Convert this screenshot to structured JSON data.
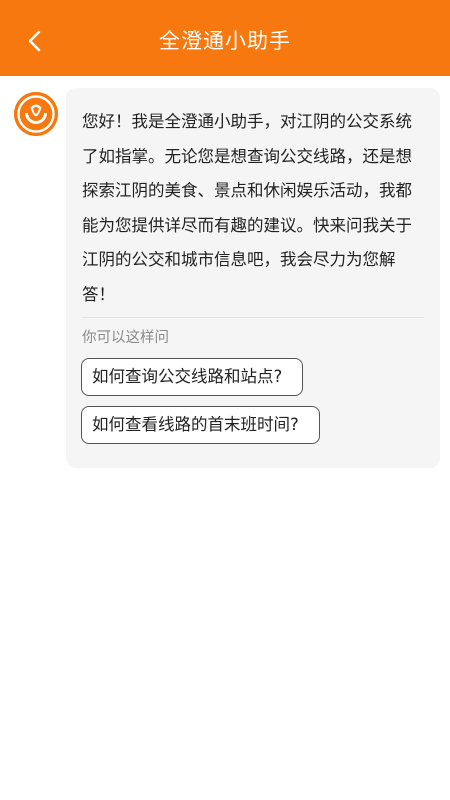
{
  "header": {
    "title": "全澄通小助手",
    "back_icon": "chevron-left-icon",
    "color": "#f7780e"
  },
  "chat": {
    "avatar_icon": "assistant-logo-icon",
    "message_lines": [
      "您好！我是全澄通小助手，对江阴的公交系统",
      "了如指掌。无论您是想查询公交线路，还是想",
      "探索江阴的美食、景点和休闲娱乐活动，我都",
      "能为您提供详尽而有趣的建议。快来问我关于",
      "江阴的公交和城市信息吧，我会尽力为您解",
      "答！"
    ],
    "suggestions_label": "你可以这样问",
    "suggestions": [
      "如何查询公交线路和站点?",
      "如何查看线路的首末班时间?"
    ]
  }
}
